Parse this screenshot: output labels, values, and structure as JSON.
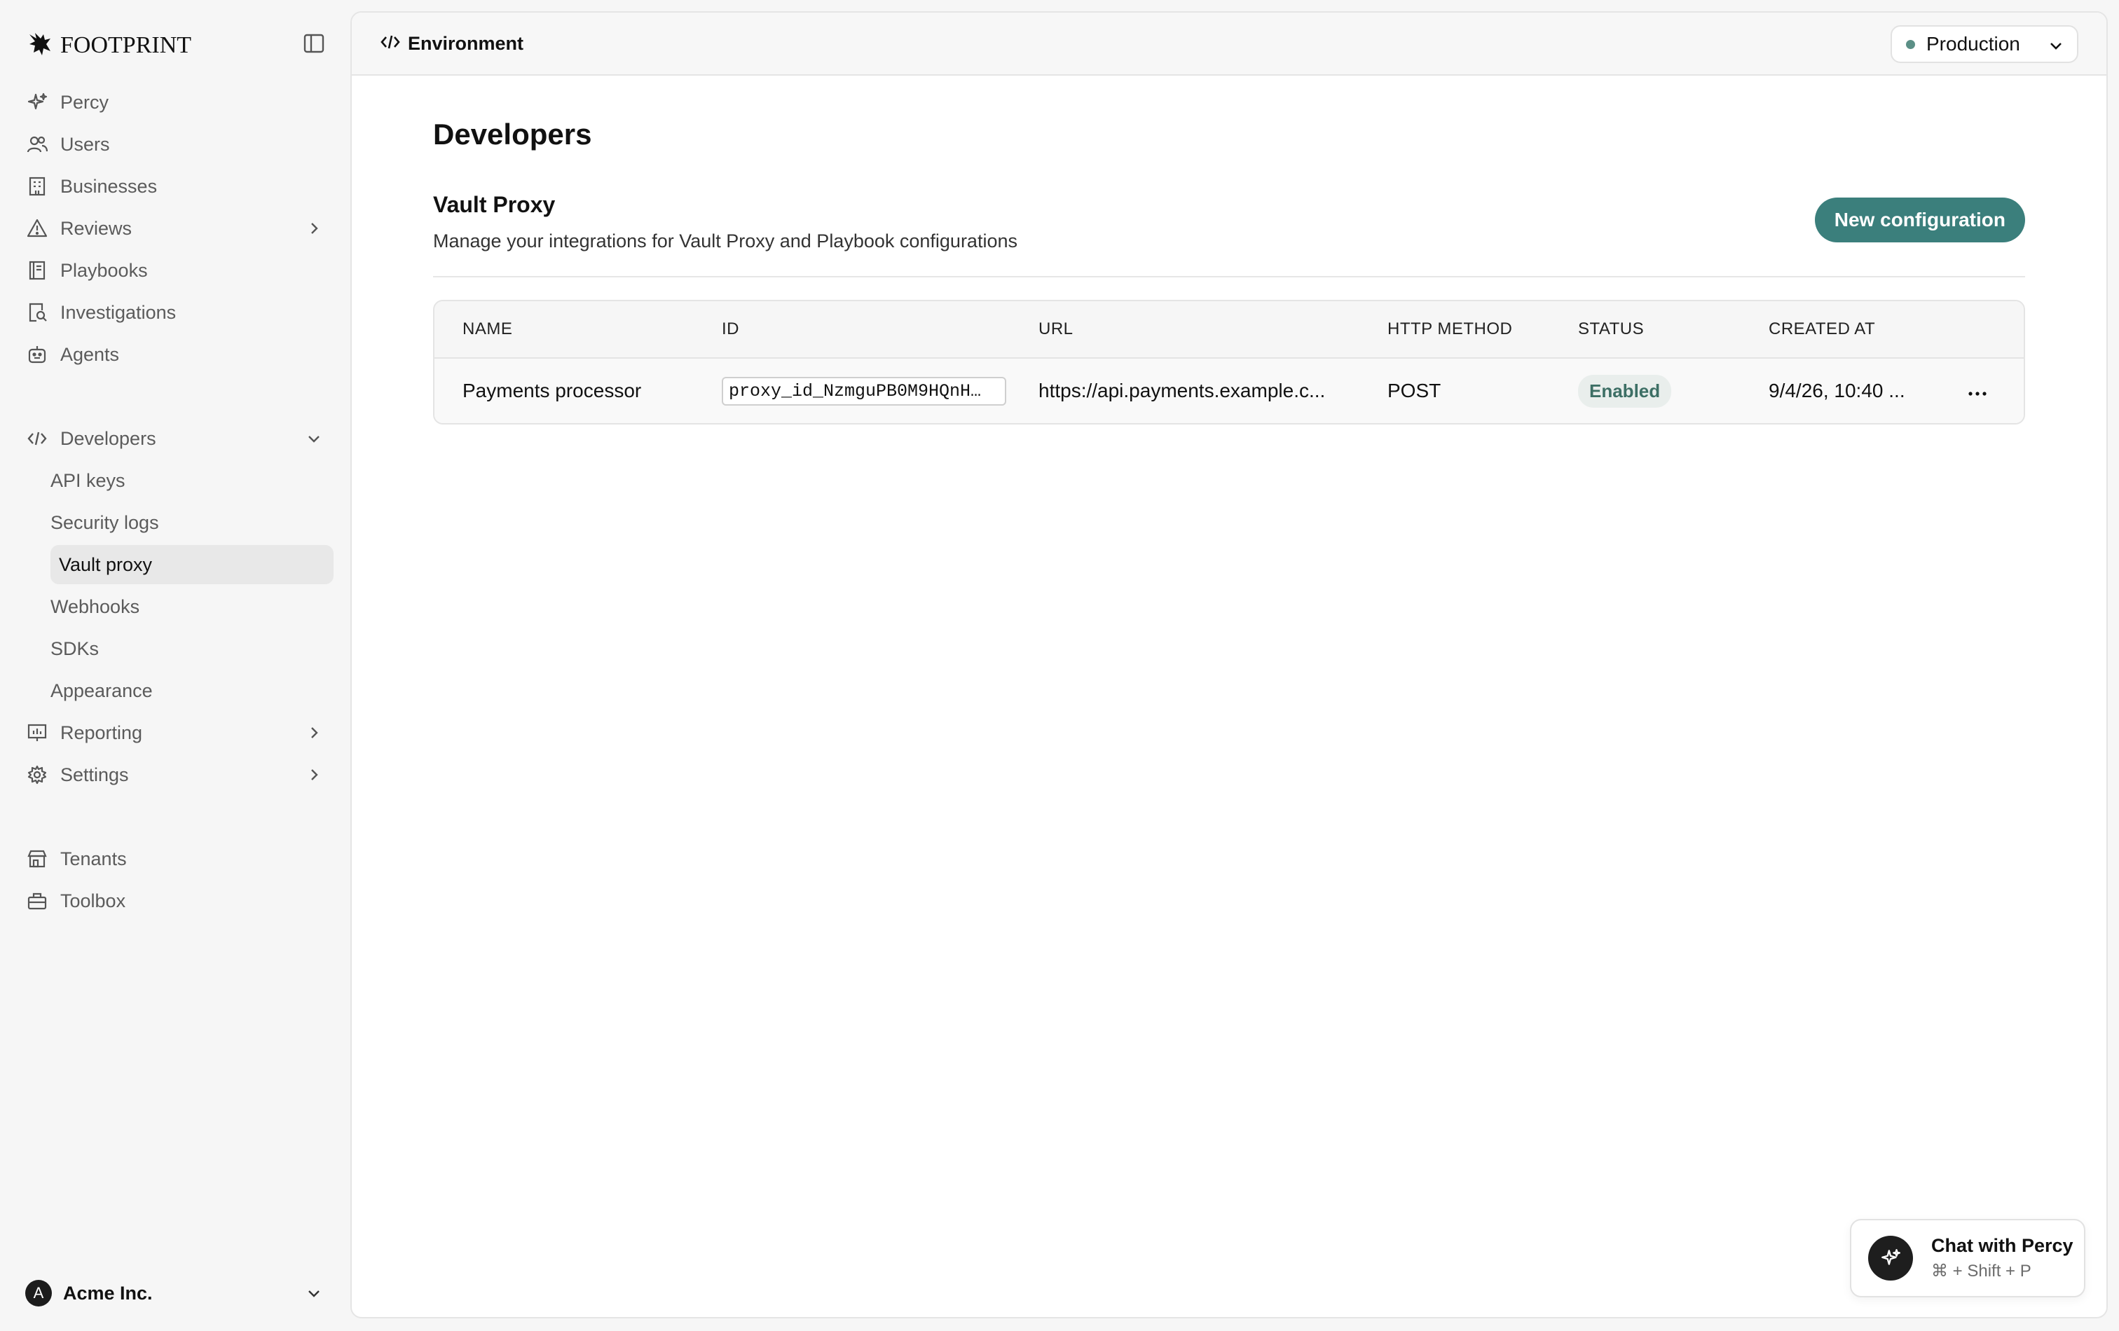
{
  "brand": {
    "name": "FOOTPRINT"
  },
  "sidebar": {
    "items": [
      {
        "label": "Percy",
        "icon": "sparkle-icon"
      },
      {
        "label": "Users",
        "icon": "users-icon"
      },
      {
        "label": "Businesses",
        "icon": "building-icon"
      },
      {
        "label": "Reviews",
        "icon": "warning-icon"
      },
      {
        "label": "Playbooks",
        "icon": "book-icon"
      },
      {
        "label": "Investigations",
        "icon": "search-document-icon"
      },
      {
        "label": "Agents",
        "icon": "robot-icon"
      },
      {
        "label": "Developers",
        "icon": "code-icon"
      },
      {
        "label": "API keys"
      },
      {
        "label": "Security logs"
      },
      {
        "label": "Vault proxy",
        "active": true
      },
      {
        "label": "Webhooks"
      },
      {
        "label": "SDKs"
      },
      {
        "label": "Appearance"
      },
      {
        "label": "Reporting",
        "icon": "chart-icon"
      },
      {
        "label": "Settings",
        "icon": "gear-icon"
      },
      {
        "label": "Tenants",
        "icon": "store-icon"
      },
      {
        "label": "Toolbox",
        "icon": "toolbox-icon"
      }
    ],
    "account": {
      "initial": "A",
      "name": "Acme Inc."
    }
  },
  "topbar": {
    "env_label": "Environment",
    "env_value": "Production"
  },
  "main": {
    "page_title": "Developers",
    "section_title": "Vault Proxy",
    "section_desc": "Manage your integrations for Vault Proxy and Playbook configurations",
    "new_button": "New configuration",
    "table": {
      "columns": [
        "NAME",
        "ID",
        "URL",
        "HTTP METHOD",
        "STATUS",
        "CREATED AT"
      ],
      "rows": [
        {
          "name": "Payments processor",
          "id": "proxy_id_NzmguPB0M9HQnH…",
          "url": "https://api.payments.example.c...",
          "method": "POST",
          "status": "Enabled",
          "created_at": "9/4/26, 10:40 ..."
        }
      ]
    }
  },
  "chat": {
    "title": "Chat with Percy",
    "shortcut": "⌘ + Shift + P"
  },
  "colors": {
    "accent": "#3b7f7c",
    "status_bg": "#e9eeec",
    "status_text": "#3d6f65",
    "env_dot": "#5b8f86"
  }
}
